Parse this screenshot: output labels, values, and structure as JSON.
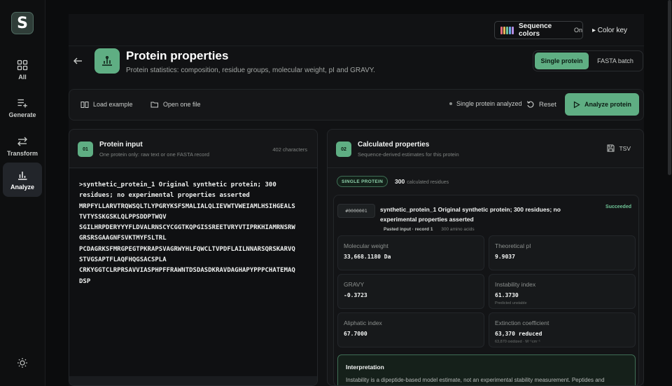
{
  "app": {
    "logo_letter": "S"
  },
  "sidebar": {
    "items": [
      {
        "label": "All",
        "icon": "grid-icon",
        "active": false
      },
      {
        "label": "Generate",
        "icon": "list-plus-icon",
        "active": false
      },
      {
        "label": "Transform",
        "icon": "arrows-swap-icon",
        "active": false
      },
      {
        "label": "Analyze",
        "icon": "bar-chart-icon",
        "active": true
      }
    ],
    "theme_icon": "sun-icon"
  },
  "topbar": {
    "sequence_colors_label": "Sequence colors",
    "sequence_colors_state": "On",
    "color_key_label": "▸ Color key"
  },
  "header": {
    "title": "Protein properties",
    "subtitle": "Protein statistics: composition, residue groups, molecular weight, pI and GRAVY.",
    "modes": [
      "Single protein",
      "FASTA batch"
    ],
    "active_mode": "Single protein"
  },
  "toolbar": {
    "load_example": "Load example",
    "open_file": "Open one file",
    "status": "Single protein analyzed",
    "reset": "Reset",
    "analyze": "Analyze protein"
  },
  "input_panel": {
    "step": "01",
    "title": "Protein input",
    "subtitle": "One protein only: raw text or one FASTA record",
    "char_count": "402 characters",
    "sequence_text": ">synthetic_protein_1 Original synthetic protein; 300\nresidues; no experimental properties asserted\nMRPFYLLARVTRQWSQLTLYPGRYKSFSMALIALQLIEVWTVWEIAMLHSIHGEALS\nTVTYSSKGSKLQLPPSDDPTWQV\nSGILHRPDERYYYFLDVALRNSCYCGGTKQPGISSREETVRYVTIPRKHIAMRNSRW\nGRSRSGAAGNFSVKTMYFSLTRL\nPCDAGRKSFMRGPEGTPKRAPSVAGRWYHLFQWCLTVPDFLAILNNARSQRSKARVQ\nSTVGSAPTFLAQFHQGSACSPLA\nCRKYGGTCLRPRSAVVIASPHPFFRAWNTDSDASDKRAVDAGHAPYPPPCHATEMAQ\nDSP"
  },
  "results_panel": {
    "step": "02",
    "title": "Calculated properties",
    "subtitle": "Sequence-derived estimates for this protein",
    "export_label": "TSV",
    "mode_badge": "SINGLE PROTEIN",
    "residue_count": "300",
    "residue_count_label": "calculated residues",
    "record": {
      "id": "#0000001",
      "title": "synthetic_protein_1 Original synthetic protein; 300 residues; no experimental properties asserted",
      "status": "Succeeded",
      "source": "Pasted input · record 1",
      "length": "300 amino acids"
    },
    "metrics": [
      {
        "label": "Molecular weight",
        "value": "33,668.1180 Da",
        "note": ""
      },
      {
        "label": "Theoretical pI",
        "value": "9.9037",
        "note": ""
      },
      {
        "label": "GRAVY",
        "value": "-0.3723",
        "note": ""
      },
      {
        "label": "Instability index",
        "value": "61.3730",
        "note": "Predicted unstable"
      },
      {
        "label": "Aliphatic index",
        "value": "67.7000",
        "note": ""
      },
      {
        "label": "Extinction coefficient",
        "value": "63,370 reduced",
        "note": "63,870 oxidized · M⁻¹cm⁻¹"
      }
    ],
    "interpretation": {
      "title": "Interpretation",
      "text": "Instability is a dipeptide-based model estimate, not an experimental stability measurement. Peptides and"
    }
  },
  "colors": {
    "accent": "#5fae83",
    "background": "#0b0c0d",
    "panel": "#151618",
    "success_text": "#6fc497"
  }
}
